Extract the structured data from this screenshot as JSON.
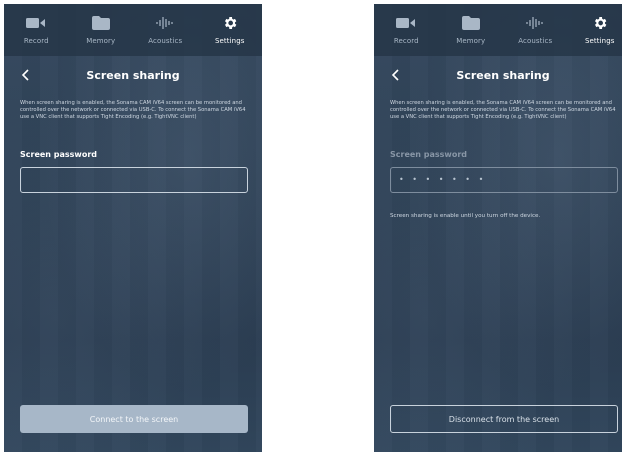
{
  "nav": {
    "record": "Record",
    "memory": "Memory",
    "acoustics": "Acoustics",
    "settings": "Settings"
  },
  "left": {
    "title": "Screen sharing",
    "description": "When screen sharing is enabled, the Sonama CAM iV64 screen can be monitored and controlled over the network or connected via USB-C. To connect the Sonama CAM iV64 use a VNC client that supports Tight Encoding (e.g. TightVNC client)",
    "password_label": "Screen password",
    "password_value": "",
    "button_label": "Connect to the screen"
  },
  "right": {
    "title": "Screen sharing",
    "description": "When screen sharing is enabled, the Sonama CAM iV64 screen can be monitored and controlled over the network or connected via USB-C. To connect the Sonama CAM iV64 use a VNC client that supports Tight Encoding (e.g. TightVNC client)",
    "password_label": "Screen password",
    "password_value": "• • • • • • •",
    "note": "Screen sharing is enable until you turn off the device.",
    "button_label": "Disconnect from the screen"
  },
  "colors": {
    "background": "#2f4257",
    "nav_active": "#ffffff",
    "nav_inactive": "#a9b7c6",
    "connect_button": "#a7b7c8"
  }
}
